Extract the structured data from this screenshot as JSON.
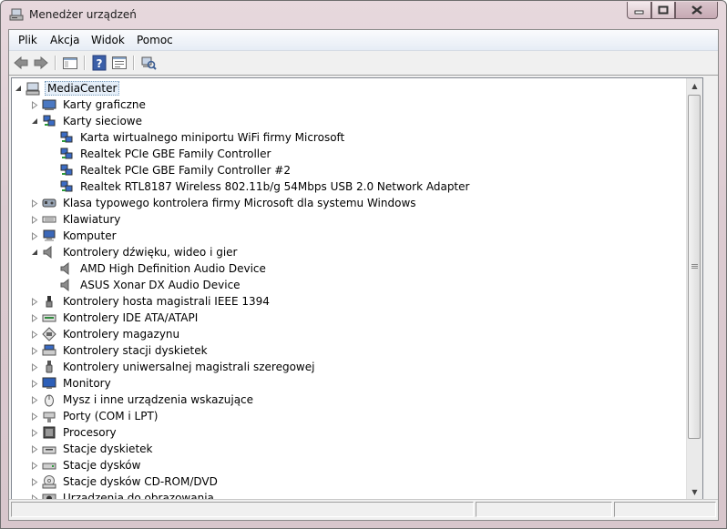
{
  "window": {
    "title": "Menedżer urządzeń"
  },
  "menu": [
    "Plik",
    "Akcja",
    "Widok",
    "Pomoc"
  ],
  "toolbar": [
    "back-icon",
    "forward-icon",
    "show-hide-console-tree-icon",
    "help-icon",
    "properties-icon",
    "scan-hardware-icon"
  ],
  "tree": {
    "root": "MediaCenter",
    "items": [
      {
        "label": "Karty graficzne",
        "level": 1,
        "expanded": false,
        "icon": "display-adapter-icon"
      },
      {
        "label": "Karty sieciowe",
        "level": 1,
        "expanded": true,
        "icon": "network-adapter-icon"
      },
      {
        "label": "Karta wirtualnego miniportu WiFi firmy Microsoft",
        "level": 2,
        "icon": "network-adapter-icon"
      },
      {
        "label": "Realtek PCIe GBE Family Controller",
        "level": 2,
        "icon": "network-adapter-icon"
      },
      {
        "label": "Realtek PCIe GBE Family Controller #2",
        "level": 2,
        "icon": "network-adapter-icon"
      },
      {
        "label": "Realtek RTL8187 Wireless 802.11b/g 54Mbps USB 2.0 Network Adapter",
        "level": 2,
        "icon": "network-adapter-icon"
      },
      {
        "label": "Klasa typowego kontrolera firmy Microsoft dla systemu Windows",
        "level": 1,
        "expanded": false,
        "icon": "controller-icon"
      },
      {
        "label": "Klawiatury",
        "level": 1,
        "expanded": false,
        "icon": "keyboard-icon"
      },
      {
        "label": "Komputer",
        "level": 1,
        "expanded": false,
        "icon": "computer-icon"
      },
      {
        "label": "Kontrolery dźwięku, wideo i gier",
        "level": 1,
        "expanded": true,
        "icon": "speaker-icon"
      },
      {
        "label": "AMD High Definition Audio Device",
        "level": 2,
        "icon": "speaker-icon"
      },
      {
        "label": "ASUS Xonar DX Audio Device",
        "level": 2,
        "icon": "speaker-icon"
      },
      {
        "label": "Kontrolery hosta magistrali IEEE 1394",
        "level": 1,
        "expanded": false,
        "icon": "firewire-icon"
      },
      {
        "label": "Kontrolery IDE ATA/ATAPI",
        "level": 1,
        "expanded": false,
        "icon": "ide-controller-icon"
      },
      {
        "label": "Kontrolery magazynu",
        "level": 1,
        "expanded": false,
        "icon": "storage-controller-icon"
      },
      {
        "label": "Kontrolery stacji dyskietek",
        "level": 1,
        "expanded": false,
        "icon": "floppy-controller-icon"
      },
      {
        "label": "Kontrolery uniwersalnej magistrali szeregowej",
        "level": 1,
        "expanded": false,
        "icon": "usb-icon"
      },
      {
        "label": "Monitory",
        "level": 1,
        "expanded": false,
        "icon": "monitor-icon"
      },
      {
        "label": "Mysz i inne urządzenia wskazujące",
        "level": 1,
        "expanded": false,
        "icon": "mouse-icon"
      },
      {
        "label": "Porty (COM i LPT)",
        "level": 1,
        "expanded": false,
        "icon": "port-icon"
      },
      {
        "label": "Procesory",
        "level": 1,
        "expanded": false,
        "icon": "processor-icon"
      },
      {
        "label": "Stacje dyskietek",
        "level": 1,
        "expanded": false,
        "icon": "floppy-drive-icon"
      },
      {
        "label": "Stacje dysków",
        "level": 1,
        "expanded": false,
        "icon": "disk-drive-icon"
      },
      {
        "label": "Stacje dysków CD-ROM/DVD",
        "level": 1,
        "expanded": false,
        "icon": "cdrom-icon"
      },
      {
        "label": "Urządzenia do obrazowania",
        "level": 1,
        "expanded": false,
        "icon": "imaging-device-icon"
      }
    ]
  }
}
